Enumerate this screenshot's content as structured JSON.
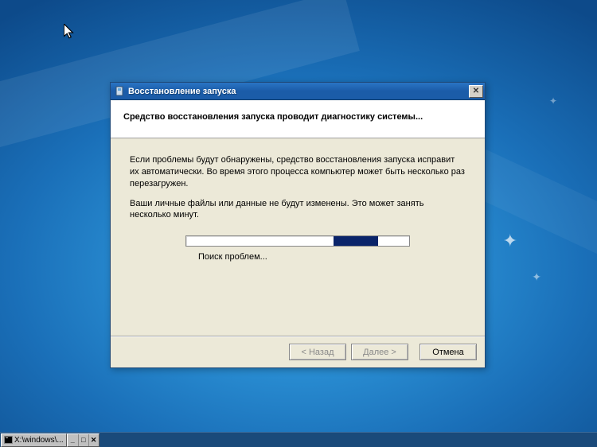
{
  "dialog": {
    "title": "Восстановление запуска",
    "header": "Средство восстановления запуска проводит диагностику системы...",
    "body_p1": "Если проблемы будут обнаружены, средство восстановления запуска исправит их автоматически. Во время этого процесса компьютер может быть несколько раз перезагружен.",
    "body_p2": "Ваши личные файлы или данные не будут изменены. Это может занять несколько минут.",
    "progress_label": "Поиск проблем...",
    "buttons": {
      "back": "< Назад",
      "next": "Далее >",
      "cancel": "Отмена"
    }
  },
  "taskbar": {
    "item1": "X:\\windows\\..."
  }
}
